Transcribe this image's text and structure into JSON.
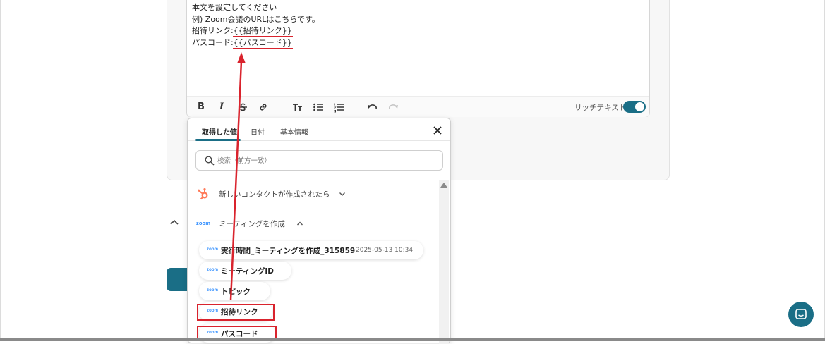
{
  "editor": {
    "lines": [
      "本文を設定してください",
      "例) Zoom会議のURLはこちらです。"
    ],
    "invite_prefix": "招待リンク:",
    "invite_var": "{{招待リンク}}",
    "pass_prefix": "パスコード:",
    "pass_var": "{{パスコード}}",
    "rich_text_label": "リッチテキスト",
    "rich_text_enabled": true
  },
  "panel": {
    "tabs": [
      {
        "label": "取得した値",
        "active": true
      },
      {
        "label": "日付",
        "active": false
      },
      {
        "label": "基本情報",
        "active": false
      }
    ],
    "search_placeholder": "検索（前方一致）",
    "sections": [
      {
        "icon": "hubspot-icon",
        "label": "新しいコンタクトが作成されたら",
        "expanded": false
      },
      {
        "icon": "zoom-logo",
        "label": "ミーティングを作成",
        "expanded": true
      }
    ],
    "zoom_logo_text": "zoom",
    "items": [
      {
        "label": "実行時間_ミーティングを作成_315859",
        "extra": "2025-05-13 10:34"
      },
      {
        "label": "ミーティングID",
        "extra": ""
      },
      {
        "label": "トピック",
        "extra": ""
      },
      {
        "label": "招待リンク",
        "extra": "",
        "highlighted": true
      },
      {
        "label": "パスコード",
        "extra": "",
        "highlighted": true
      }
    ]
  },
  "colors": {
    "accent": "#1a6e86",
    "highlight_red": "#d9232d",
    "zoom_blue": "#2d8cff",
    "hubspot_orange": "#ff7a59"
  }
}
